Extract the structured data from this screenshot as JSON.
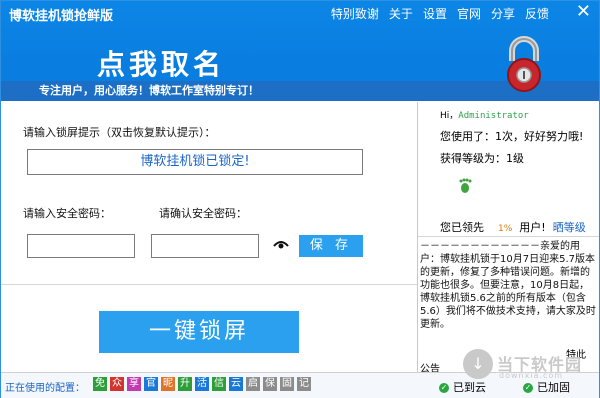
{
  "window": {
    "title": "博软挂机锁抢鲜版",
    "menu": [
      "特别致谢",
      "关于",
      "设置",
      "官网",
      "分享",
      "反馈"
    ],
    "close_glyph": "✕"
  },
  "header": {
    "brand": "点我取名",
    "slogan": "专注用户，用心服务！博软工作室特别专订！",
    "lock_icon": "padlock-icon"
  },
  "form": {
    "tip_label": "请输入锁屏提示（双击恢复默认提示）：",
    "tip_value": "博软挂机锁已锁定!",
    "pwd_label": "请输入安全密码：",
    "pwd_confirm_label": "请确认安全密码：",
    "save_label": "保 存",
    "lock_label": "一键锁屏",
    "eye_icon": "eye-icon"
  },
  "user": {
    "hi_prefix": "Hi，",
    "name": "Administrator",
    "used": "您使用了：1次，好好努力哦!",
    "level": "获得等级为：1级",
    "ahead_prefix": "您已领先",
    "ahead_pct": "1%",
    "ahead_suffix": "用户!",
    "upgrade": "晒等级"
  },
  "news": {
    "text": "－－－－－－－－－－－－亲爱的用户：博软挂机锁于10月7日迎来5.7版本的更新，修复了多种错误问题。新增的功能也很多。但要注意，10月8日起，博软挂机锁5.6之前的所有版本（包含5.6）我们将不做技术支持，请大家及时更新。",
    "notice_left": "公告",
    "notice_right": "特此"
  },
  "bottom": {
    "config_label": "正在使用的配置：",
    "chips": [
      {
        "label": "免",
        "color": "#2e9e3a"
      },
      {
        "label": "众",
        "color": "#d2352e"
      },
      {
        "label": "享",
        "color": "#c23bb0"
      },
      {
        "label": "官",
        "color": "#1a79d8"
      },
      {
        "label": "昵",
        "color": "#e0732a"
      },
      {
        "label": "升",
        "color": "#2e9e3a"
      },
      {
        "label": "活",
        "color": "#1a79d8"
      },
      {
        "label": "信",
        "color": "#2e9e3a"
      },
      {
        "label": "云",
        "color": "#1a79d8"
      },
      {
        "label": "启",
        "color": "#8c8c8c"
      },
      {
        "label": "保",
        "color": "#8c8c8c"
      },
      {
        "label": "固",
        "color": "#8c8c8c"
      },
      {
        "label": "记",
        "color": "#8c8c8c"
      }
    ],
    "cloud_status": "已到云",
    "lock_status": "已加固"
  },
  "watermark": {
    "text": "当下软件园",
    "site": "downxia.com"
  }
}
